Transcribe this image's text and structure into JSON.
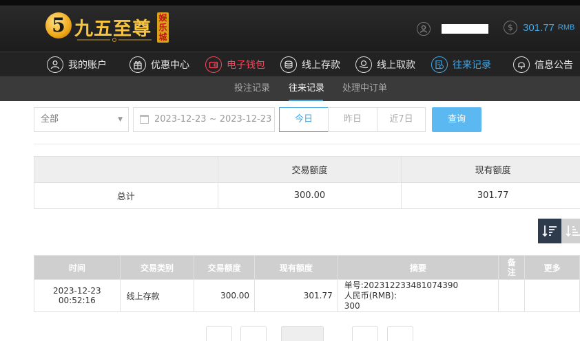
{
  "header": {
    "logo_numeral": "5",
    "logo_text": "九五至尊",
    "logo_badge": "娱乐城",
    "balance_amount": "301.77",
    "balance_unit": "RMB",
    "currency_symbol": "$"
  },
  "mainnav": {
    "items": [
      {
        "label": "我的账户",
        "icon": "user-icon"
      },
      {
        "label": "优惠中心",
        "icon": "gift-icon"
      },
      {
        "label": "电子钱包",
        "icon": "wallet-icon",
        "color": "#f1485e"
      },
      {
        "label": "线上存款",
        "icon": "deposit-icon"
      },
      {
        "label": "线上取款",
        "icon": "withdraw-icon"
      },
      {
        "label": "往来记录",
        "icon": "records-icon",
        "color": "#41a6e6"
      },
      {
        "label": "信息公告",
        "icon": "bell-icon"
      }
    ]
  },
  "subnav": {
    "items": [
      {
        "label": "投注记录"
      },
      {
        "label": "往来记录",
        "active": true
      },
      {
        "label": "处理中订单"
      }
    ]
  },
  "filter": {
    "type_select": "全部",
    "date_range": "2023-12-23 ~ 2023-12-23",
    "quick_ranges": [
      "今日",
      "昨日",
      "近7日"
    ],
    "active_range": "今日",
    "query_label": "查询"
  },
  "summary": {
    "headers": [
      "",
      "交易额度",
      "现有额度"
    ],
    "row": {
      "label": "总计",
      "amount": "300.00",
      "balance": "301.77"
    }
  },
  "records": {
    "headers": [
      "时间",
      "交易类别",
      "交易额度",
      "现有额度",
      "摘要",
      "备注",
      "更多"
    ],
    "rows": [
      {
        "time": "2023-12-23 00:52:16",
        "type": "线上存款",
        "amount": "300.00",
        "balance": "301.77",
        "summary_line1": "单号:202312233481074390",
        "summary_line2": "人民币(RMB):",
        "summary_line3": "300",
        "note": "",
        "more": ""
      }
    ]
  },
  "colors": {
    "accent_blue": "#41a6e6",
    "wallet_red": "#f1485e",
    "header_bg": "#232323",
    "gold": "#f6c343"
  }
}
